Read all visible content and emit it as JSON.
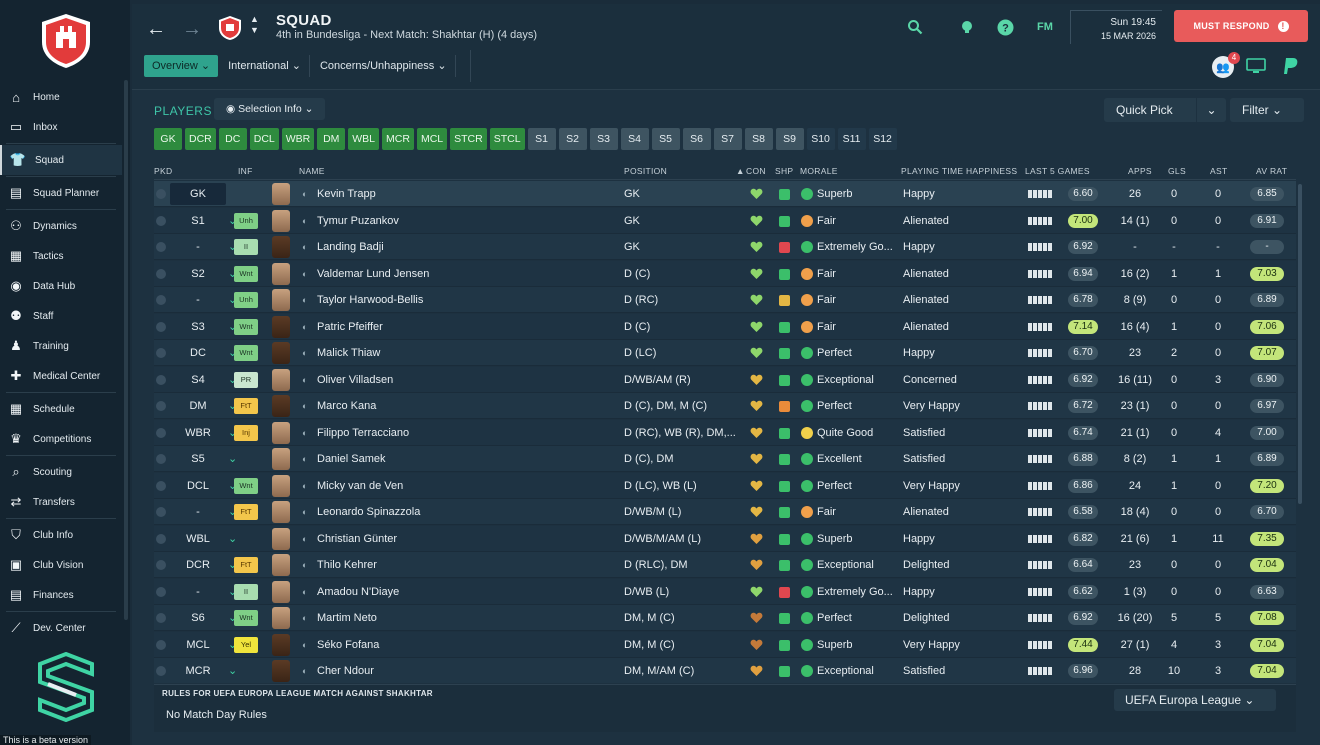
{
  "sidebar": {
    "items": [
      {
        "label": "Home",
        "icon": "home-icon",
        "glyph": "⌂"
      },
      {
        "label": "Inbox",
        "icon": "inbox-icon",
        "glyph": "▭"
      },
      {
        "label": "Squad",
        "icon": "squad-icon",
        "glyph": "👕"
      },
      {
        "label": "Squad Planner",
        "icon": "planner-icon",
        "glyph": "▤"
      },
      {
        "label": "Dynamics",
        "icon": "dynamics-icon",
        "glyph": "⚇"
      },
      {
        "label": "Tactics",
        "icon": "tactics-icon",
        "glyph": "▦"
      },
      {
        "label": "Data Hub",
        "icon": "data-hub-icon",
        "glyph": "◉"
      },
      {
        "label": "Staff",
        "icon": "staff-icon",
        "glyph": "⚉"
      },
      {
        "label": "Training",
        "icon": "training-icon",
        "glyph": "♟"
      },
      {
        "label": "Medical Center",
        "icon": "medical-icon",
        "glyph": "✚"
      },
      {
        "label": "Schedule",
        "icon": "schedule-icon",
        "glyph": "▦"
      },
      {
        "label": "Competitions",
        "icon": "trophy-icon",
        "glyph": "♛"
      },
      {
        "label": "Scouting",
        "icon": "scouting-icon",
        "glyph": "⌕"
      },
      {
        "label": "Transfers",
        "icon": "transfers-icon",
        "glyph": "⇄"
      },
      {
        "label": "Club Info",
        "icon": "shield-icon",
        "glyph": "⛉"
      },
      {
        "label": "Club Vision",
        "icon": "vision-icon",
        "glyph": "▣"
      },
      {
        "label": "Finances",
        "icon": "finances-icon",
        "glyph": "▤"
      },
      {
        "label": "Dev. Center",
        "icon": "dev-center-icon",
        "glyph": "⟋"
      }
    ],
    "beta_text": "This is a beta version"
  },
  "header": {
    "title": "SQUAD",
    "subtitle": "4th in Bundesliga - Next Match: Shakhtar (H) (4 days)",
    "time": "Sun 19:45",
    "date": "15 MAR 2026",
    "must_respond": "MUST RESPOND",
    "fm_label": "FM",
    "social_badge": "4"
  },
  "tabs": [
    {
      "label": "Overview",
      "active": true
    },
    {
      "label": "International",
      "active": false
    },
    {
      "label": "Concerns/Unhappiness",
      "active": false
    }
  ],
  "players_label": "PLAYERS",
  "selection_info": "Selection Info",
  "quick_pick": "Quick Pick",
  "filter": "Filter",
  "chips": [
    {
      "label": "GK",
      "style": "green"
    },
    {
      "label": "DCR",
      "style": "green"
    },
    {
      "label": "DC",
      "style": "green"
    },
    {
      "label": "DCL",
      "style": "green"
    },
    {
      "label": "WBR",
      "style": "green"
    },
    {
      "label": "DM",
      "style": "green"
    },
    {
      "label": "WBL",
      "style": "green"
    },
    {
      "label": "MCR",
      "style": "green"
    },
    {
      "label": "MCL",
      "style": "green"
    },
    {
      "label": "STCR",
      "style": "green"
    },
    {
      "label": "STCL",
      "style": "green"
    },
    {
      "label": "S1",
      "style": "grey"
    },
    {
      "label": "S2",
      "style": "grey"
    },
    {
      "label": "S3",
      "style": "grey"
    },
    {
      "label": "S4",
      "style": "grey"
    },
    {
      "label": "S5",
      "style": "grey"
    },
    {
      "label": "S6",
      "style": "grey"
    },
    {
      "label": "S7",
      "style": "grey"
    },
    {
      "label": "S8",
      "style": "grey"
    },
    {
      "label": "S9",
      "style": "grey"
    },
    {
      "label": "S10",
      "style": "dark"
    },
    {
      "label": "S11",
      "style": "dark"
    },
    {
      "label": "S12",
      "style": "dark"
    }
  ],
  "columns": {
    "pkd": "PKD",
    "inf": "INF",
    "name": "NAME",
    "position": "POSITION",
    "con": "CON",
    "shp": "SHP",
    "morale": "MORALE",
    "pth": "PLAYING TIME HAPPINESS",
    "last5": "LAST 5 GAMES",
    "apps": "APPS",
    "gls": "GLS",
    "ast": "AST",
    "avrat": "AV RAT"
  },
  "players": [
    {
      "pkd": "GK",
      "inf": "",
      "inf_style": "",
      "name": "Kevin Trapp",
      "position": "GK",
      "con_color": "#8ed66b",
      "shp": "green",
      "morale_color": "#3bbf6a",
      "morale": "Superb",
      "pth": "Happy",
      "last5": "6.60",
      "last5_hi": false,
      "apps": "26",
      "gls": "0",
      "ast": "0",
      "avrat": "6.85",
      "avrat_hi": false,
      "face": "light"
    },
    {
      "pkd": "S1",
      "inf": "Unh",
      "inf_style": "unh",
      "name": "Tymur Puzankov",
      "position": "GK",
      "con_color": "#8ed66b",
      "shp": "green",
      "morale_color": "#f0a04b",
      "morale": "Fair",
      "pth": "Alienated",
      "last5": "7.00",
      "last5_hi": true,
      "apps": "14 (1)",
      "gls": "0",
      "ast": "0",
      "avrat": "6.91",
      "avrat_hi": false,
      "face": "light"
    },
    {
      "pkd": "-",
      "inf": "II",
      "inf_style": "ii",
      "name": "Landing Badji",
      "position": "GK",
      "con_color": "#8ed66b",
      "shp": "red",
      "morale_color": "#3bbf6a",
      "morale": "Extremely Go...",
      "pth": "Happy",
      "last5": "6.92",
      "last5_hi": false,
      "apps": "-",
      "gls": "-",
      "ast": "-",
      "avrat": "-",
      "avrat_hi": false,
      "face": "dark"
    },
    {
      "pkd": "S2",
      "inf": "Wnt",
      "inf_style": "wnt",
      "name": "Valdemar Lund Jensen",
      "position": "D (C)",
      "con_color": "#8ed66b",
      "shp": "green",
      "morale_color": "#f0a04b",
      "morale": "Fair",
      "pth": "Alienated",
      "last5": "6.94",
      "last5_hi": false,
      "apps": "16 (2)",
      "gls": "1",
      "ast": "1",
      "avrat": "7.03",
      "avrat_hi": true,
      "face": "light"
    },
    {
      "pkd": "-",
      "inf": "Unh",
      "inf_style": "unh",
      "name": "Taylor Harwood-Bellis",
      "position": "D (RC)",
      "con_color": "#8ed66b",
      "shp": "amber",
      "morale_color": "#f0a04b",
      "morale": "Fair",
      "pth": "Alienated",
      "last5": "6.78",
      "last5_hi": false,
      "apps": "8 (9)",
      "gls": "0",
      "ast": "0",
      "avrat": "6.89",
      "avrat_hi": false,
      "face": "light"
    },
    {
      "pkd": "S3",
      "inf": "Wnt",
      "inf_style": "wnt",
      "name": "Patric Pfeiffer",
      "position": "D (C)",
      "con_color": "#8ed66b",
      "shp": "green",
      "morale_color": "#f0a04b",
      "morale": "Fair",
      "pth": "Alienated",
      "last5": "7.14",
      "last5_hi": true,
      "apps": "16 (4)",
      "gls": "1",
      "ast": "0",
      "avrat": "7.06",
      "avrat_hi": true,
      "face": "dark"
    },
    {
      "pkd": "DC",
      "inf": "Wnt",
      "inf_style": "wnt",
      "name": "Malick Thiaw",
      "position": "D (LC)",
      "con_color": "#8ed66b",
      "shp": "green",
      "morale_color": "#3bbf6a",
      "morale": "Perfect",
      "pth": "Happy",
      "last5": "6.70",
      "last5_hi": false,
      "apps": "23",
      "gls": "2",
      "ast": "0",
      "avrat": "7.07",
      "avrat_hi": true,
      "face": "dark"
    },
    {
      "pkd": "S4",
      "inf": "PR",
      "inf_style": "pr",
      "name": "Oliver Villadsen",
      "position": "D/WB/AM (R)",
      "con_color": "#e3b644",
      "shp": "green",
      "morale_color": "#3bbf6a",
      "morale": "Exceptional",
      "pth": "Concerned",
      "last5": "6.92",
      "last5_hi": false,
      "apps": "16 (11)",
      "gls": "0",
      "ast": "3",
      "avrat": "6.90",
      "avrat_hi": false,
      "face": "light"
    },
    {
      "pkd": "DM",
      "inf": "FtT",
      "inf_style": "fit",
      "name": "Marco Kana",
      "position": "D (C), DM, M (C)",
      "con_color": "#e3b644",
      "shp": "orange",
      "morale_color": "#3bbf6a",
      "morale": "Perfect",
      "pth": "Very Happy",
      "last5": "6.72",
      "last5_hi": false,
      "apps": "23 (1)",
      "gls": "0",
      "ast": "0",
      "avrat": "6.97",
      "avrat_hi": false,
      "face": "dark"
    },
    {
      "pkd": "WBR",
      "inf": "Inj",
      "inf_style": "inj",
      "name": "Filippo Terracciano",
      "position": "D (RC), WB (R), DM,...",
      "con_color": "#e3b644",
      "shp": "green",
      "morale_color": "#f0d04b",
      "morale": "Quite Good",
      "pth": "Satisfied",
      "last5": "6.74",
      "last5_hi": false,
      "apps": "21 (1)",
      "gls": "0",
      "ast": "4",
      "avrat": "7.00",
      "avrat_hi": false,
      "face": "light"
    },
    {
      "pkd": "S5",
      "inf": "",
      "inf_style": "",
      "name": "Daniel Samek",
      "position": "D (C), DM",
      "con_color": "#e3b644",
      "shp": "green",
      "morale_color": "#3bbf6a",
      "morale": "Excellent",
      "pth": "Satisfied",
      "last5": "6.88",
      "last5_hi": false,
      "apps": "8 (2)",
      "gls": "1",
      "ast": "1",
      "avrat": "6.89",
      "avrat_hi": false,
      "face": "light"
    },
    {
      "pkd": "DCL",
      "inf": "Wnt",
      "inf_style": "wnt",
      "name": "Micky van de Ven",
      "position": "D (LC), WB (L)",
      "con_color": "#e3b644",
      "shp": "green",
      "morale_color": "#3bbf6a",
      "morale": "Perfect",
      "pth": "Very Happy",
      "last5": "6.86",
      "last5_hi": false,
      "apps": "24",
      "gls": "1",
      "ast": "0",
      "avrat": "7.20",
      "avrat_hi": true,
      "face": "light"
    },
    {
      "pkd": "-",
      "inf": "FtT",
      "inf_style": "fit",
      "name": "Leonardo Spinazzola",
      "position": "D/WB/M (L)",
      "con_color": "#e3b644",
      "shp": "green",
      "morale_color": "#f0a04b",
      "morale": "Fair",
      "pth": "Alienated",
      "last5": "6.58",
      "last5_hi": false,
      "apps": "18 (4)",
      "gls": "0",
      "ast": "0",
      "avrat": "6.70",
      "avrat_hi": false,
      "face": "light"
    },
    {
      "pkd": "WBL",
      "inf": "",
      "inf_style": "",
      "name": "Christian Günter",
      "position": "D/WB/M/AM (L)",
      "con_color": "#e0a040",
      "shp": "green",
      "morale_color": "#3bbf6a",
      "morale": "Superb",
      "pth": "Happy",
      "last5": "6.82",
      "last5_hi": false,
      "apps": "21 (6)",
      "gls": "1",
      "ast": "11",
      "avrat": "7.35",
      "avrat_hi": true,
      "face": "light"
    },
    {
      "pkd": "DCR",
      "inf": "FtT",
      "inf_style": "fit",
      "name": "Thilo Kehrer",
      "position": "D (RLC), DM",
      "con_color": "#e0a040",
      "shp": "green",
      "morale_color": "#3bbf6a",
      "morale": "Exceptional",
      "pth": "Delighted",
      "last5": "6.64",
      "last5_hi": false,
      "apps": "23",
      "gls": "0",
      "ast": "0",
      "avrat": "7.04",
      "avrat_hi": true,
      "face": "light"
    },
    {
      "pkd": "-",
      "inf": "II",
      "inf_style": "ii",
      "name": "Amadou N'Diaye",
      "position": "D/WB (L)",
      "con_color": "#8ed66b",
      "shp": "red",
      "morale_color": "#3bbf6a",
      "morale": "Extremely Go...",
      "pth": "Happy",
      "last5": "6.62",
      "last5_hi": false,
      "apps": "1 (3)",
      "gls": "0",
      "ast": "0",
      "avrat": "6.63",
      "avrat_hi": false,
      "face": "light"
    },
    {
      "pkd": "S6",
      "inf": "Wnt",
      "inf_style": "wnt",
      "name": "Martim Neto",
      "position": "DM, M (C)",
      "con_color": "#c47a3a",
      "shp": "green",
      "morale_color": "#3bbf6a",
      "morale": "Perfect",
      "pth": "Delighted",
      "last5": "6.92",
      "last5_hi": false,
      "apps": "16 (20)",
      "gls": "5",
      "ast": "5",
      "avrat": "7.08",
      "avrat_hi": true,
      "face": "light"
    },
    {
      "pkd": "MCL",
      "inf": "Yel",
      "inf_style": "yel",
      "name": "Séko Fofana",
      "position": "DM, M (C)",
      "con_color": "#c47a3a",
      "shp": "green",
      "morale_color": "#3bbf6a",
      "morale": "Superb",
      "pth": "Very Happy",
      "last5": "7.44",
      "last5_hi": true,
      "apps": "27 (1)",
      "gls": "4",
      "ast": "3",
      "avrat": "7.04",
      "avrat_hi": true,
      "face": "dark"
    },
    {
      "pkd": "MCR",
      "inf": "",
      "inf_style": "",
      "name": "Cher Ndour",
      "position": "DM, M/AM (C)",
      "con_color": "#e0a040",
      "shp": "green",
      "morale_color": "#3bbf6a",
      "morale": "Exceptional",
      "pth": "Satisfied",
      "last5": "6.96",
      "last5_hi": false,
      "apps": "28",
      "gls": "10",
      "ast": "3",
      "avrat": "7.04",
      "avrat_hi": true,
      "face": "dark"
    }
  ],
  "rules": {
    "title": "RULES FOR UEFA EUROPA LEAGUE MATCH AGAINST SHAKHTAR",
    "body": "No Match Day Rules",
    "competition": "UEFA Europa League"
  },
  "colors": {
    "accent": "#2fa38d",
    "must_respond": "#e85b5b",
    "chip_green": "#2e8b3e",
    "rating_high": "#c3e57a"
  }
}
